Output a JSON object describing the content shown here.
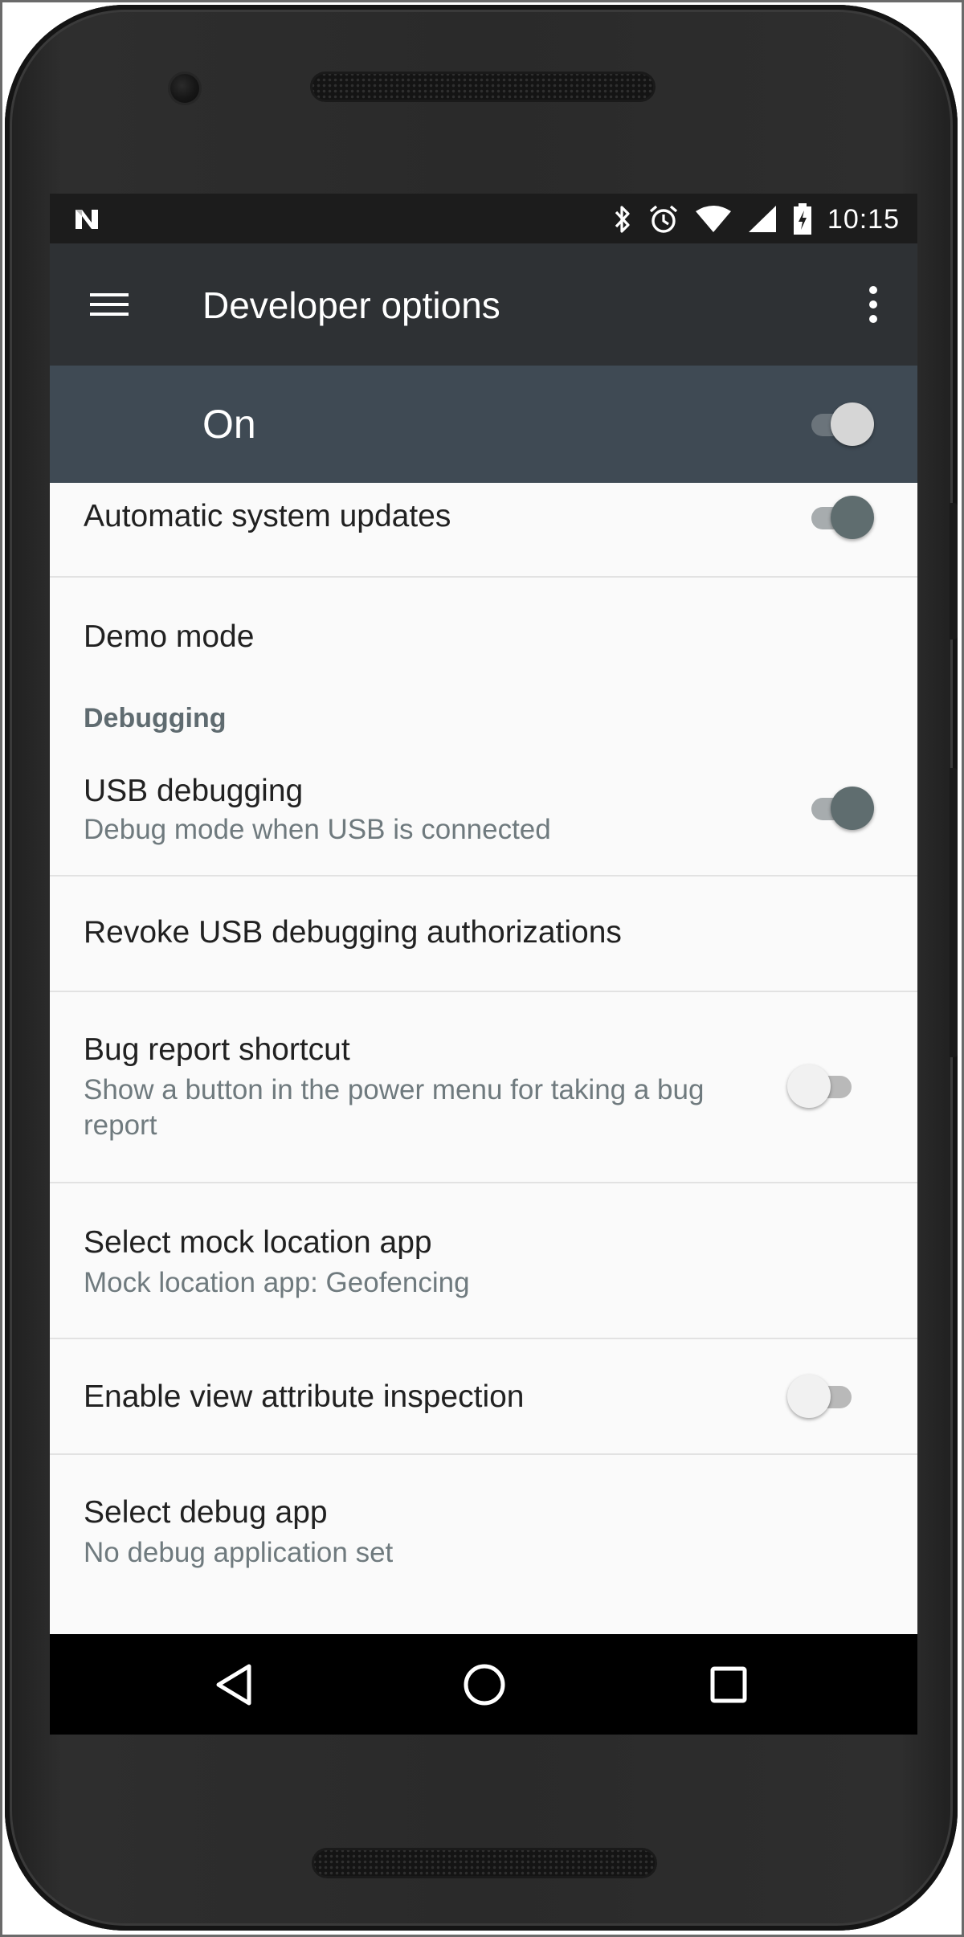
{
  "status_bar": {
    "time": "10:15",
    "icons": [
      "notification-n-icon",
      "bluetooth-icon",
      "alarm-icon",
      "wifi-icon",
      "signal-icon",
      "battery-icon"
    ]
  },
  "toolbar": {
    "title": "Developer options",
    "menu_icon": "hamburger-menu-icon",
    "overflow_icon": "more-vert-icon"
  },
  "master_switch": {
    "label": "On",
    "state": "on"
  },
  "settings": {
    "auto_updates": {
      "title": "Automatic system updates",
      "toggle": "on"
    },
    "demo_mode": {
      "title": "Demo mode"
    },
    "debugging_header": "Debugging",
    "usb_debugging": {
      "title": "USB debugging",
      "summary": "Debug mode when USB is connected",
      "toggle": "on"
    },
    "revoke_usb": {
      "title": "Revoke USB debugging authorizations"
    },
    "bug_report": {
      "title": "Bug report shortcut",
      "summary": "Show a button in the power menu for taking a bug report",
      "toggle": "off"
    },
    "mock_location": {
      "title": "Select mock location app",
      "summary": "Mock location app: Geofencing"
    },
    "view_attribute": {
      "title": "Enable view attribute inspection",
      "toggle": "off"
    },
    "debug_app": {
      "title": "Select debug app",
      "summary": "No debug application set"
    }
  },
  "nav_bar": {
    "back_icon": "back-triangle-icon",
    "home_icon": "home-circle-icon",
    "recents_icon": "recents-square-icon"
  },
  "colors": {
    "status_bar": "#1c1c1c",
    "toolbar": "#2e3134",
    "master_bar": "#3f4a54",
    "list_bg": "#fafafa",
    "toggle_on_thumb": "#5f6d6f",
    "toggle_on_track": "#a7acae",
    "toggle_off_thumb": "#f1f1f1",
    "toggle_off_track": "#b9b9b9",
    "master_thumb": "#d6d6d6",
    "master_track": "#6b747b"
  }
}
